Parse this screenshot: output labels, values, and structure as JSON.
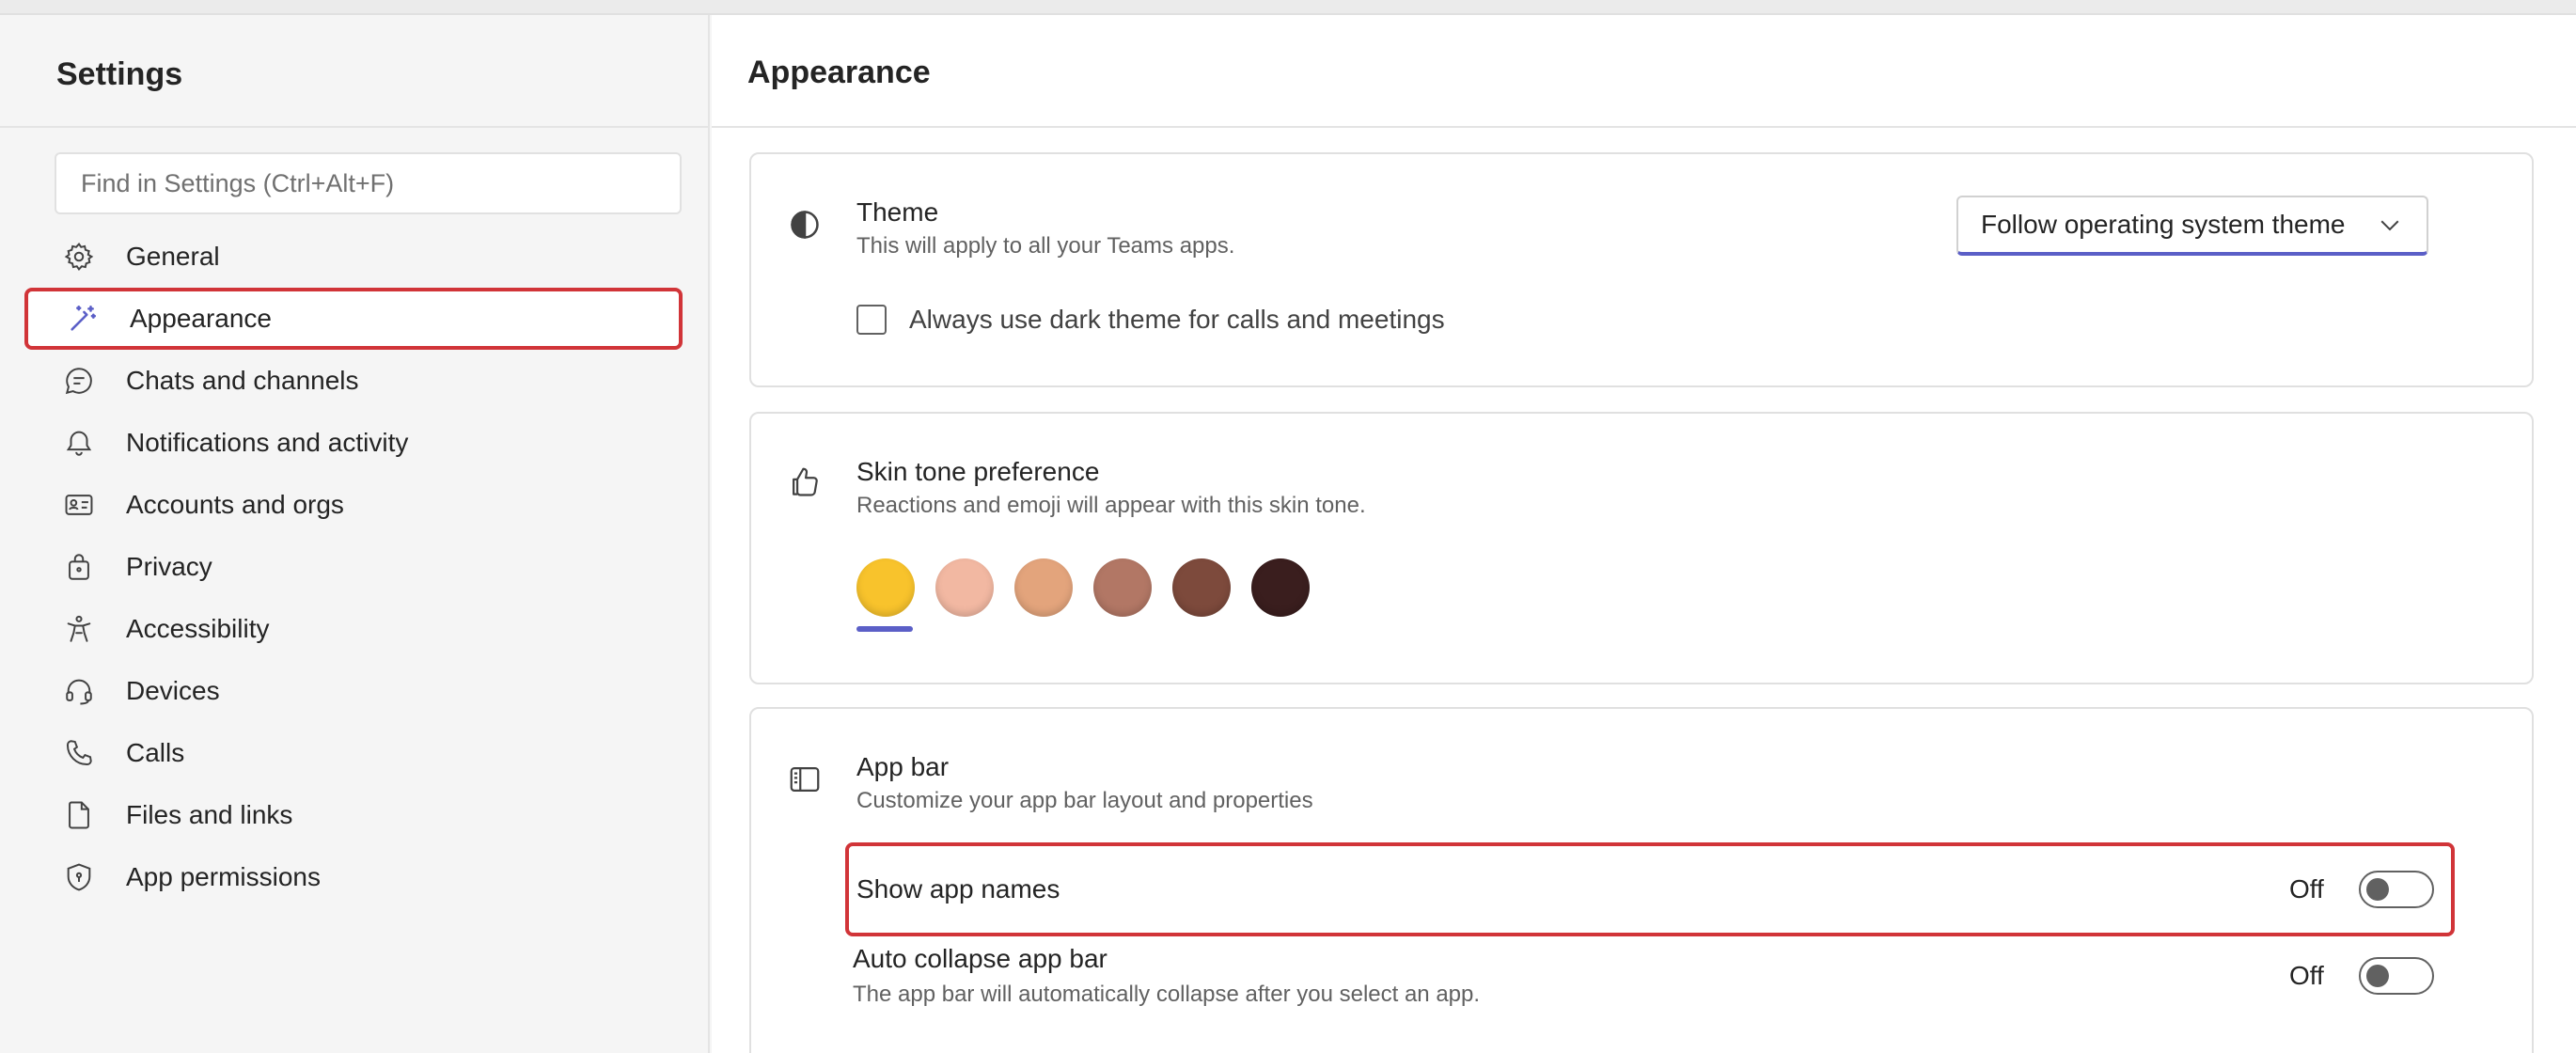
{
  "sidebar": {
    "title": "Settings",
    "search_placeholder": "Find in Settings (Ctrl+Alt+F)",
    "items": [
      {
        "label": "General",
        "icon": "gear-icon"
      },
      {
        "label": "Appearance",
        "icon": "magic-wand-icon",
        "selected": true
      },
      {
        "label": "Chats and channels",
        "icon": "chat-icon"
      },
      {
        "label": "Notifications and activity",
        "icon": "bell-icon"
      },
      {
        "label": "Accounts and orgs",
        "icon": "contact-card-icon"
      },
      {
        "label": "Privacy",
        "icon": "lock-bag-icon"
      },
      {
        "label": "Accessibility",
        "icon": "accessibility-icon"
      },
      {
        "label": "Devices",
        "icon": "headset-icon"
      },
      {
        "label": "Calls",
        "icon": "phone-icon"
      },
      {
        "label": "Files and links",
        "icon": "document-icon"
      },
      {
        "label": "App permissions",
        "icon": "shield-icon"
      }
    ]
  },
  "main": {
    "title": "Appearance",
    "theme": {
      "title": "Theme",
      "description": "This will apply to all your Teams apps.",
      "dropdown_value": "Follow operating system theme",
      "checkbox_label": "Always use dark theme for calls and meetings",
      "checkbox_checked": false
    },
    "skin_tone": {
      "title": "Skin tone preference",
      "description": "Reactions and emoji will appear with this skin tone.",
      "tones": [
        "#f8c32c",
        "#f2b8a2",
        "#e3a47c",
        "#b27765",
        "#7d4a3c",
        "#3a1e1e"
      ],
      "selected_index": 0
    },
    "app_bar": {
      "title": "App bar",
      "description": "Customize your app bar layout and properties",
      "settings": [
        {
          "name": "Show app names",
          "state": "Off",
          "description": ""
        },
        {
          "name": "Auto collapse app bar",
          "state": "Off",
          "description": "The app bar will automatically collapse after you select an app."
        }
      ]
    }
  },
  "colors": {
    "accent": "#5b5fc7",
    "highlight": "#d13438"
  }
}
